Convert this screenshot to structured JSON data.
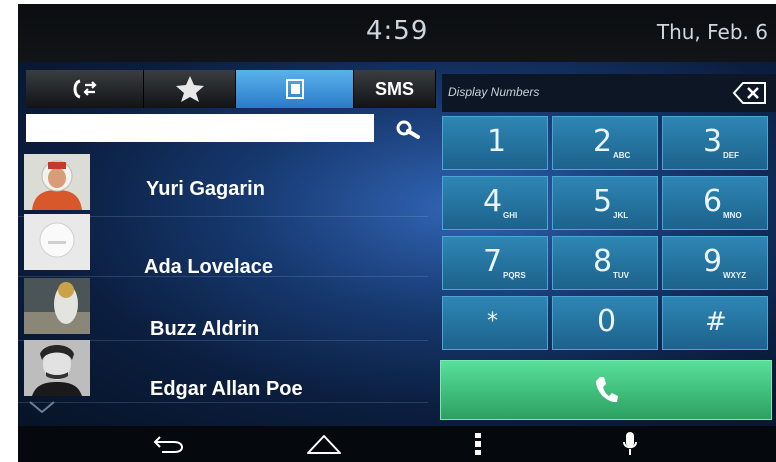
{
  "status_bar": {
    "time": "4:59",
    "date": "Thu, Feb. 6"
  },
  "tabs": [
    {
      "icon": "recent-calls-icon",
      "label": ""
    },
    {
      "icon": "star-icon",
      "label": ""
    },
    {
      "icon": "contacts-icon",
      "label": "",
      "active": true
    },
    {
      "icon": "",
      "label": "SMS"
    }
  ],
  "search": {
    "value": "",
    "placeholder": ""
  },
  "contacts": [
    {
      "name": "Yuri Gagarin",
      "avatar": "cosmonaut-photo"
    },
    {
      "name": "Ada Lovelace",
      "avatar": "placeholder-avatar"
    },
    {
      "name": "Buzz Aldrin",
      "avatar": "astronaut-photo"
    },
    {
      "name": "Edgar Allan Poe",
      "avatar": "portrait-photo"
    }
  ],
  "dialpad": {
    "display_label": "Display Numbers",
    "keys": [
      {
        "digit": "1",
        "letters": ""
      },
      {
        "digit": "2",
        "letters": "ABC"
      },
      {
        "digit": "3",
        "letters": "DEF"
      },
      {
        "digit": "4",
        "letters": "GHI"
      },
      {
        "digit": "5",
        "letters": "JKL"
      },
      {
        "digit": "6",
        "letters": "MNO"
      },
      {
        "digit": "7",
        "letters": "PQRS"
      },
      {
        "digit": "8",
        "letters": "TUV"
      },
      {
        "digit": "9",
        "letters": "WXYZ"
      },
      {
        "digit": "*",
        "letters": ""
      },
      {
        "digit": "0",
        "letters": ""
      },
      {
        "digit": "#",
        "letters": ""
      }
    ]
  },
  "nav_bar": {
    "icons": [
      "back-icon",
      "home-icon",
      "menu-icon",
      "microphone-icon"
    ]
  },
  "colors": {
    "accent_blue": "#2a7bc7",
    "key_blue": "#1c628c",
    "call_green": "#2ca061"
  }
}
